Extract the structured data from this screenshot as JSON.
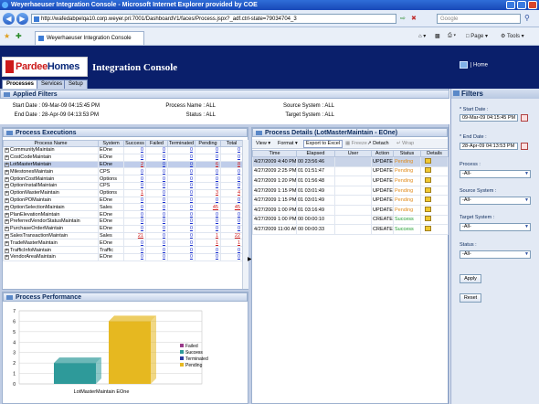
{
  "window": {
    "title": "Weyerhaeuser Integration Console - Microsoft Internet Explorer provided by COE"
  },
  "browser": {
    "url": "http://wafedabpelqa10.corp.weyer.pri:7001/DashboardV1/faces/Process.jspx?_adf.ctrl-state=79034704_3",
    "search_placeholder": "Google",
    "tab_label": "Weyerhaeuser Integration Console",
    "page_menu": "Page",
    "tools_menu": "Tools"
  },
  "app": {
    "logo_part1": "Pardee",
    "logo_part2": "Homes",
    "title": "Integration Console",
    "home_label": "Home",
    "tabs": [
      "Processes",
      "Services",
      "Setup"
    ]
  },
  "applied_filters": {
    "title": "Applied Filters",
    "start_date_label": "Start Date :",
    "start_date": "09-Mar-09 04:15:45 PM",
    "end_date_label": "End Date :",
    "end_date": "28-Apr-09 04:13:53 PM",
    "process_name_label": "Process Name :",
    "process_name": "ALL",
    "status_label": "Status :",
    "status": "ALL",
    "source_system_label": "Source System :",
    "source_system": "ALL",
    "target_system_label": "Target System :",
    "target_system": "ALL"
  },
  "process_executions": {
    "title": "Process Executions",
    "columns": [
      "Process Name",
      "System",
      "Success",
      "Failed",
      "Terminated",
      "Pending",
      "Total"
    ],
    "rows": [
      [
        "CommunityMaintain",
        "EOne",
        "0",
        "0",
        "0",
        "0",
        "0"
      ],
      [
        "CostCodeMaintain",
        "EOne",
        "0",
        "0",
        "0",
        "0",
        "0"
      ],
      [
        "LotMasterMaintain",
        "EOne",
        "2",
        "0",
        "0",
        "6",
        "8"
      ],
      [
        "MilestonesMaintain",
        "CPS",
        "0",
        "0",
        "0",
        "0",
        "0"
      ],
      [
        "OptionCostMaintain",
        "Options",
        "0",
        "0",
        "0",
        "0",
        "0"
      ],
      [
        "OptionInstallMaintain",
        "CPS",
        "0",
        "0",
        "0",
        "0",
        "0"
      ],
      [
        "OptionMasterMaintain",
        "Options",
        "1",
        "0",
        "0",
        "3",
        "4"
      ],
      [
        "OptionPOMaintain",
        "EOne",
        "0",
        "0",
        "0",
        "0",
        "0"
      ],
      [
        "OptionSelectionMaintain",
        "Sales",
        "0",
        "0",
        "0",
        "45",
        "45"
      ],
      [
        "PlanElevationMaintain",
        "EOne",
        "0",
        "0",
        "0",
        "0",
        "0"
      ],
      [
        "PreferredVendorStatusMaintain",
        "EOne",
        "0",
        "0",
        "0",
        "0",
        "0"
      ],
      [
        "PurchaseOrderMaintain",
        "EOne",
        "0",
        "0",
        "0",
        "0",
        "0"
      ],
      [
        "SalesTransactionMaintain",
        "Sales",
        "21",
        "0",
        "0",
        "1",
        "22"
      ],
      [
        "TradeMasterMaintain",
        "EOne",
        "0",
        "0",
        "0",
        "1",
        "1"
      ],
      [
        "TrafficInfoMaintain",
        "Traffic",
        "0",
        "0",
        "0",
        "0",
        "0"
      ],
      [
        "VendorAreaMaintain",
        "EOne",
        "0",
        "0",
        "0",
        "0",
        "0"
      ]
    ]
  },
  "process_performance": {
    "title": "Process Performance"
  },
  "chart_data": {
    "type": "bar",
    "categories": [
      "LotMasterMaintain EOne"
    ],
    "series": [
      {
        "name": "Failed",
        "values": [
          0
        ],
        "color": "#9a3a8a"
      },
      {
        "name": "Success",
        "values": [
          2
        ],
        "color": "#2e9a9a"
      },
      {
        "name": "Terminated",
        "values": [
          0
        ],
        "color": "#2a3aa0"
      },
      {
        "name": "Pending",
        "values": [
          6
        ],
        "color": "#e6b820"
      }
    ],
    "ylim": [
      0,
      7
    ],
    "yticks": [
      "0",
      "1",
      "2",
      "3",
      "4",
      "5",
      "6",
      "7"
    ],
    "legend": "right",
    "grid": true
  },
  "process_details": {
    "title": "Process Details (LotMasterMaintain - EOne)",
    "toolbar": {
      "view": "View",
      "format": "Format",
      "export": "Export to Excel",
      "freeze": "Freeze",
      "detach": "Detach",
      "wrap": "Wrap"
    },
    "columns": [
      "Time",
      "Elapsed",
      "User",
      "Action",
      "Status",
      "Details"
    ],
    "rows": [
      [
        "4/27/2009 4:40 PM",
        "00 23:56:46",
        "",
        "UPDATE",
        "Pending"
      ],
      [
        "4/27/2009 2:25 PM",
        "01 01:51:47",
        "",
        "UPDATE",
        "Pending"
      ],
      [
        "4/27/2009 1:20 PM",
        "01 01:56:48",
        "",
        "UPDATE",
        "Pending"
      ],
      [
        "4/27/2009 1:15 PM",
        "01 03:01:49",
        "",
        "UPDATE",
        "Pending"
      ],
      [
        "4/27/2009 1:15 PM",
        "01 03:01:49",
        "",
        "UPDATE",
        "Pending"
      ],
      [
        "4/27/2009 1:00 PM",
        "01 03:16:49",
        "",
        "UPDATE",
        "Pending"
      ],
      [
        "4/27/2009 1:00 PM",
        "00 00:00:10",
        "",
        "CREATE",
        "Success"
      ],
      [
        "4/27/2009 11:00 AM",
        "00 00:00:33",
        "",
        "CREATE",
        "Success"
      ]
    ]
  },
  "filters_panel": {
    "title": "Filters",
    "start_date_label": "* Start Date :",
    "start_date": "09-Mar-09 04:15:45 PM",
    "end_date_label": "* End Date :",
    "end_date": "28-Apr-09 04:13:53 PM",
    "process_label": "Process :",
    "process_value": "-All-",
    "source_label": "Source System :",
    "source_value": "-All-",
    "target_label": "Target System :",
    "target_value": "-All-",
    "status_label": "Status :",
    "status_value": "-All-",
    "apply_label": "Apply",
    "reset_label": "Reset"
  }
}
